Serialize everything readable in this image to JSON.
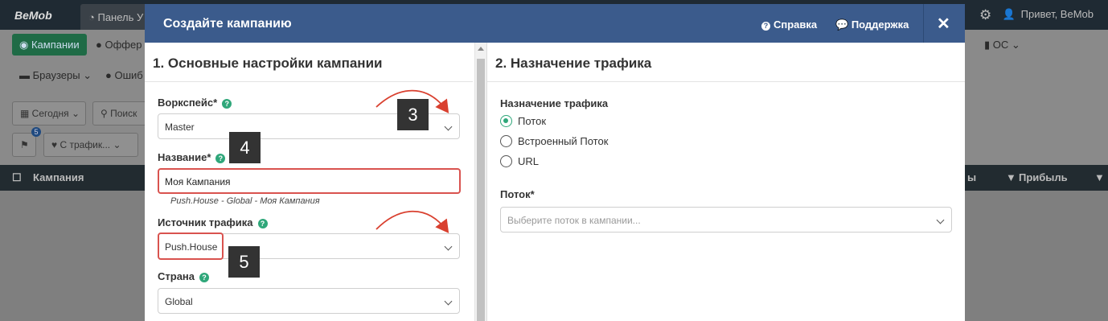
{
  "background": {
    "logo": "BeMob",
    "dashboard_tab": "Панель У",
    "greeting": "Привет, BeMob",
    "nav": {
      "campaigns": "Кампании",
      "offers": "Оффер",
      "os": "ОС",
      "browsers": "Браузеры",
      "errors": "Ошиб"
    },
    "filters": {
      "date": "Сегодня",
      "search": "Поиск",
      "traffic": "С трафик...",
      "badge": "5"
    },
    "table": {
      "col_campaign": "Кампания",
      "col_partial": "ы",
      "col_profit": "Прибыль"
    }
  },
  "modal": {
    "title": "Создайте кампанию",
    "help_link": "Справка",
    "support_link": "Поддержка",
    "close": "✕",
    "left": {
      "section_title": "1. Основные настройки кампании",
      "workspace_label": "Воркспейс*",
      "workspace_value": "Master",
      "name_label": "Название*",
      "name_value": "Моя Кампания",
      "name_hint": "Push.House - Global - Моя Кампания",
      "traffic_source_label": "Источник трафика",
      "traffic_source_value": "Push.House",
      "country_label": "Страна",
      "country_value": "Global"
    },
    "right": {
      "section_title": "2. Назначение трафика",
      "destination_label": "Назначение трафика",
      "options": [
        "Поток",
        "Встроенный Поток",
        "URL"
      ],
      "selected_option": "Поток",
      "flow_label": "Поток*",
      "flow_placeholder": "Выберите поток в кампании..."
    }
  },
  "annotations": {
    "step3": "3",
    "step4": "4",
    "step5": "5",
    "arrow_color": "#d9402f",
    "highlight_color": "#d9534f"
  },
  "colors": {
    "header": "#3b5b8c",
    "accent_green": "#2fa77a"
  }
}
